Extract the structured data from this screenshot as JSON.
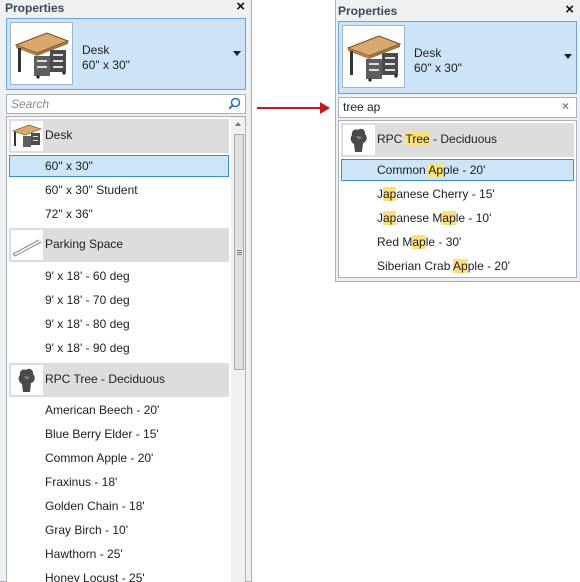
{
  "colors": {
    "accent": "#cde3f7",
    "selection_border": "#3e8fd0",
    "highlight": "#fde07a",
    "arrow": "#c11a1a"
  },
  "left_panel": {
    "title": "Properties",
    "close_glyph": "×",
    "type_selector": {
      "family": "Desk",
      "type": "60\" x 30\""
    },
    "search": {
      "placeholder": "Search",
      "value": "",
      "icon": "search-icon"
    },
    "groups": [
      {
        "label": "Desk",
        "icon": "desk-thumbnail",
        "items": [
          {
            "label": "60\" x 30\"",
            "selected": true
          },
          {
            "label": "60\" x 30\" Student"
          },
          {
            "label": "72\" x 36\""
          }
        ]
      },
      {
        "label": "Parking Space",
        "icon": "parking-thumbnail",
        "items": [
          {
            "label": "9' x 18' - 60 deg"
          },
          {
            "label": "9' x 18' - 70 deg"
          },
          {
            "label": "9' x 18' - 80 deg"
          },
          {
            "label": "9' x 18' - 90 deg"
          }
        ]
      },
      {
        "label": "RPC Tree - Deciduous",
        "icon": "tree-thumbnail",
        "items": [
          {
            "label": "American Beech - 20'"
          },
          {
            "label": "Blue Berry Elder - 15'"
          },
          {
            "label": "Common Apple - 20'"
          },
          {
            "label": "Fraxinus - 18'"
          },
          {
            "label": "Golden Chain - 18'"
          },
          {
            "label": "Gray Birch - 10'"
          },
          {
            "label": "Hawthorn - 25'"
          },
          {
            "label": "Honey Locust - 25'"
          }
        ]
      }
    ]
  },
  "right_panel": {
    "title": "Properties",
    "close_glyph": "×",
    "type_selector": {
      "family": "Desk",
      "type": "60\" x 30\""
    },
    "search": {
      "value": "tree ap",
      "clear_glyph": "×"
    },
    "group": {
      "icon": "tree-thumbnail",
      "label_parts": [
        {
          "t": "RPC "
        },
        {
          "t": "Tree",
          "hl": true
        },
        {
          "t": " - Deciduous"
        }
      ]
    },
    "results": [
      {
        "selected": true,
        "parts": [
          {
            "t": "Common "
          },
          {
            "t": "Ap",
            "hl": true
          },
          {
            "t": "ple - 20'"
          }
        ]
      },
      {
        "parts": [
          {
            "t": "J"
          },
          {
            "t": "ap",
            "hl": true
          },
          {
            "t": "anese Cherry - 15'"
          }
        ]
      },
      {
        "parts": [
          {
            "t": "J"
          },
          {
            "t": "ap",
            "hl": true
          },
          {
            "t": "anese M"
          },
          {
            "t": "ap",
            "hl": true
          },
          {
            "t": "le - 10'"
          }
        ]
      },
      {
        "parts": [
          {
            "t": "Red M"
          },
          {
            "t": "ap",
            "hl": true
          },
          {
            "t": "le - 30'"
          }
        ]
      },
      {
        "parts": [
          {
            "t": "Siberian Crab "
          },
          {
            "t": "Ap",
            "hl": true
          },
          {
            "t": "ple - 20'"
          }
        ]
      }
    ]
  }
}
